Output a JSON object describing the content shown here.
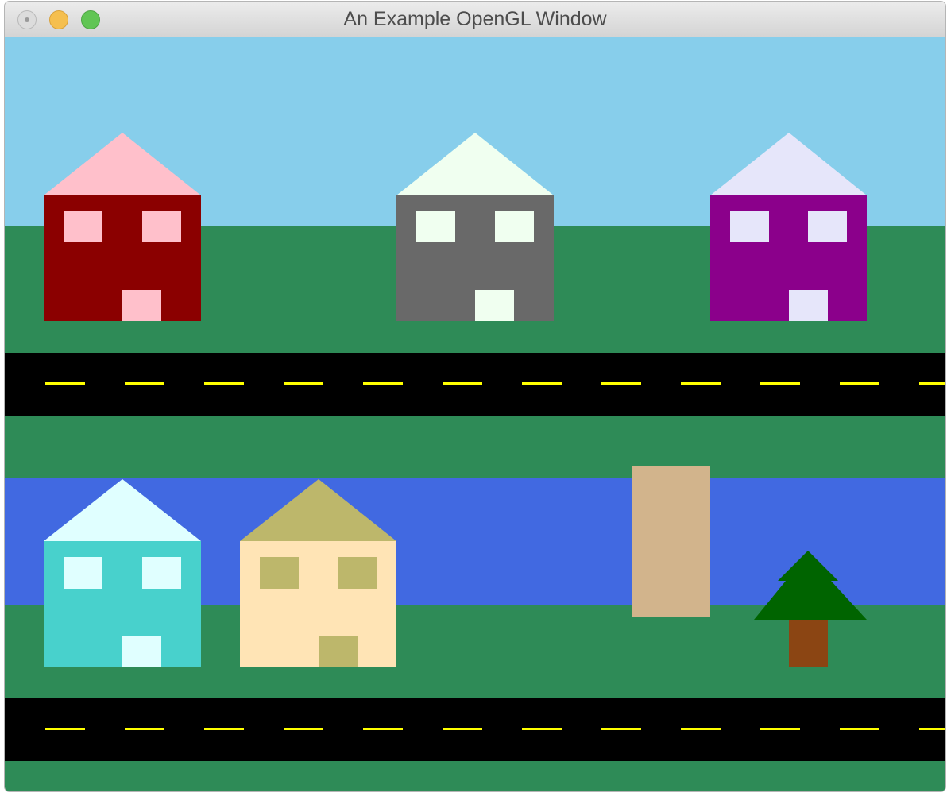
{
  "window": {
    "title": "An Example OpenGL Window",
    "buttons": [
      "close",
      "minimize",
      "zoom"
    ]
  },
  "scene": {
    "sky_color": "#87CEEB",
    "grass_color": "#2E8B57",
    "river_color": "#4169E1",
    "road_color": "#000000",
    "lane_color": "#FFFF00",
    "houses": [
      {
        "name": "house-red",
        "body_color": "#8B0000",
        "trim_color": "#FFC0CB"
      },
      {
        "name": "house-gray",
        "body_color": "#696969",
        "trim_color": "#F0FFF0"
      },
      {
        "name": "house-purple",
        "body_color": "#8B008B",
        "trim_color": "#E6E6FA"
      },
      {
        "name": "house-turquoise",
        "body_color": "#48D1CC",
        "trim_color": "#E0FFFF"
      },
      {
        "name": "house-moccasin",
        "body_color": "#FFE4B5",
        "trim_color": "#BDB76B"
      }
    ],
    "bridge_color": "#D2B48C",
    "tree": {
      "foliage_color": "#006400",
      "trunk_color": "#8B4513"
    }
  }
}
